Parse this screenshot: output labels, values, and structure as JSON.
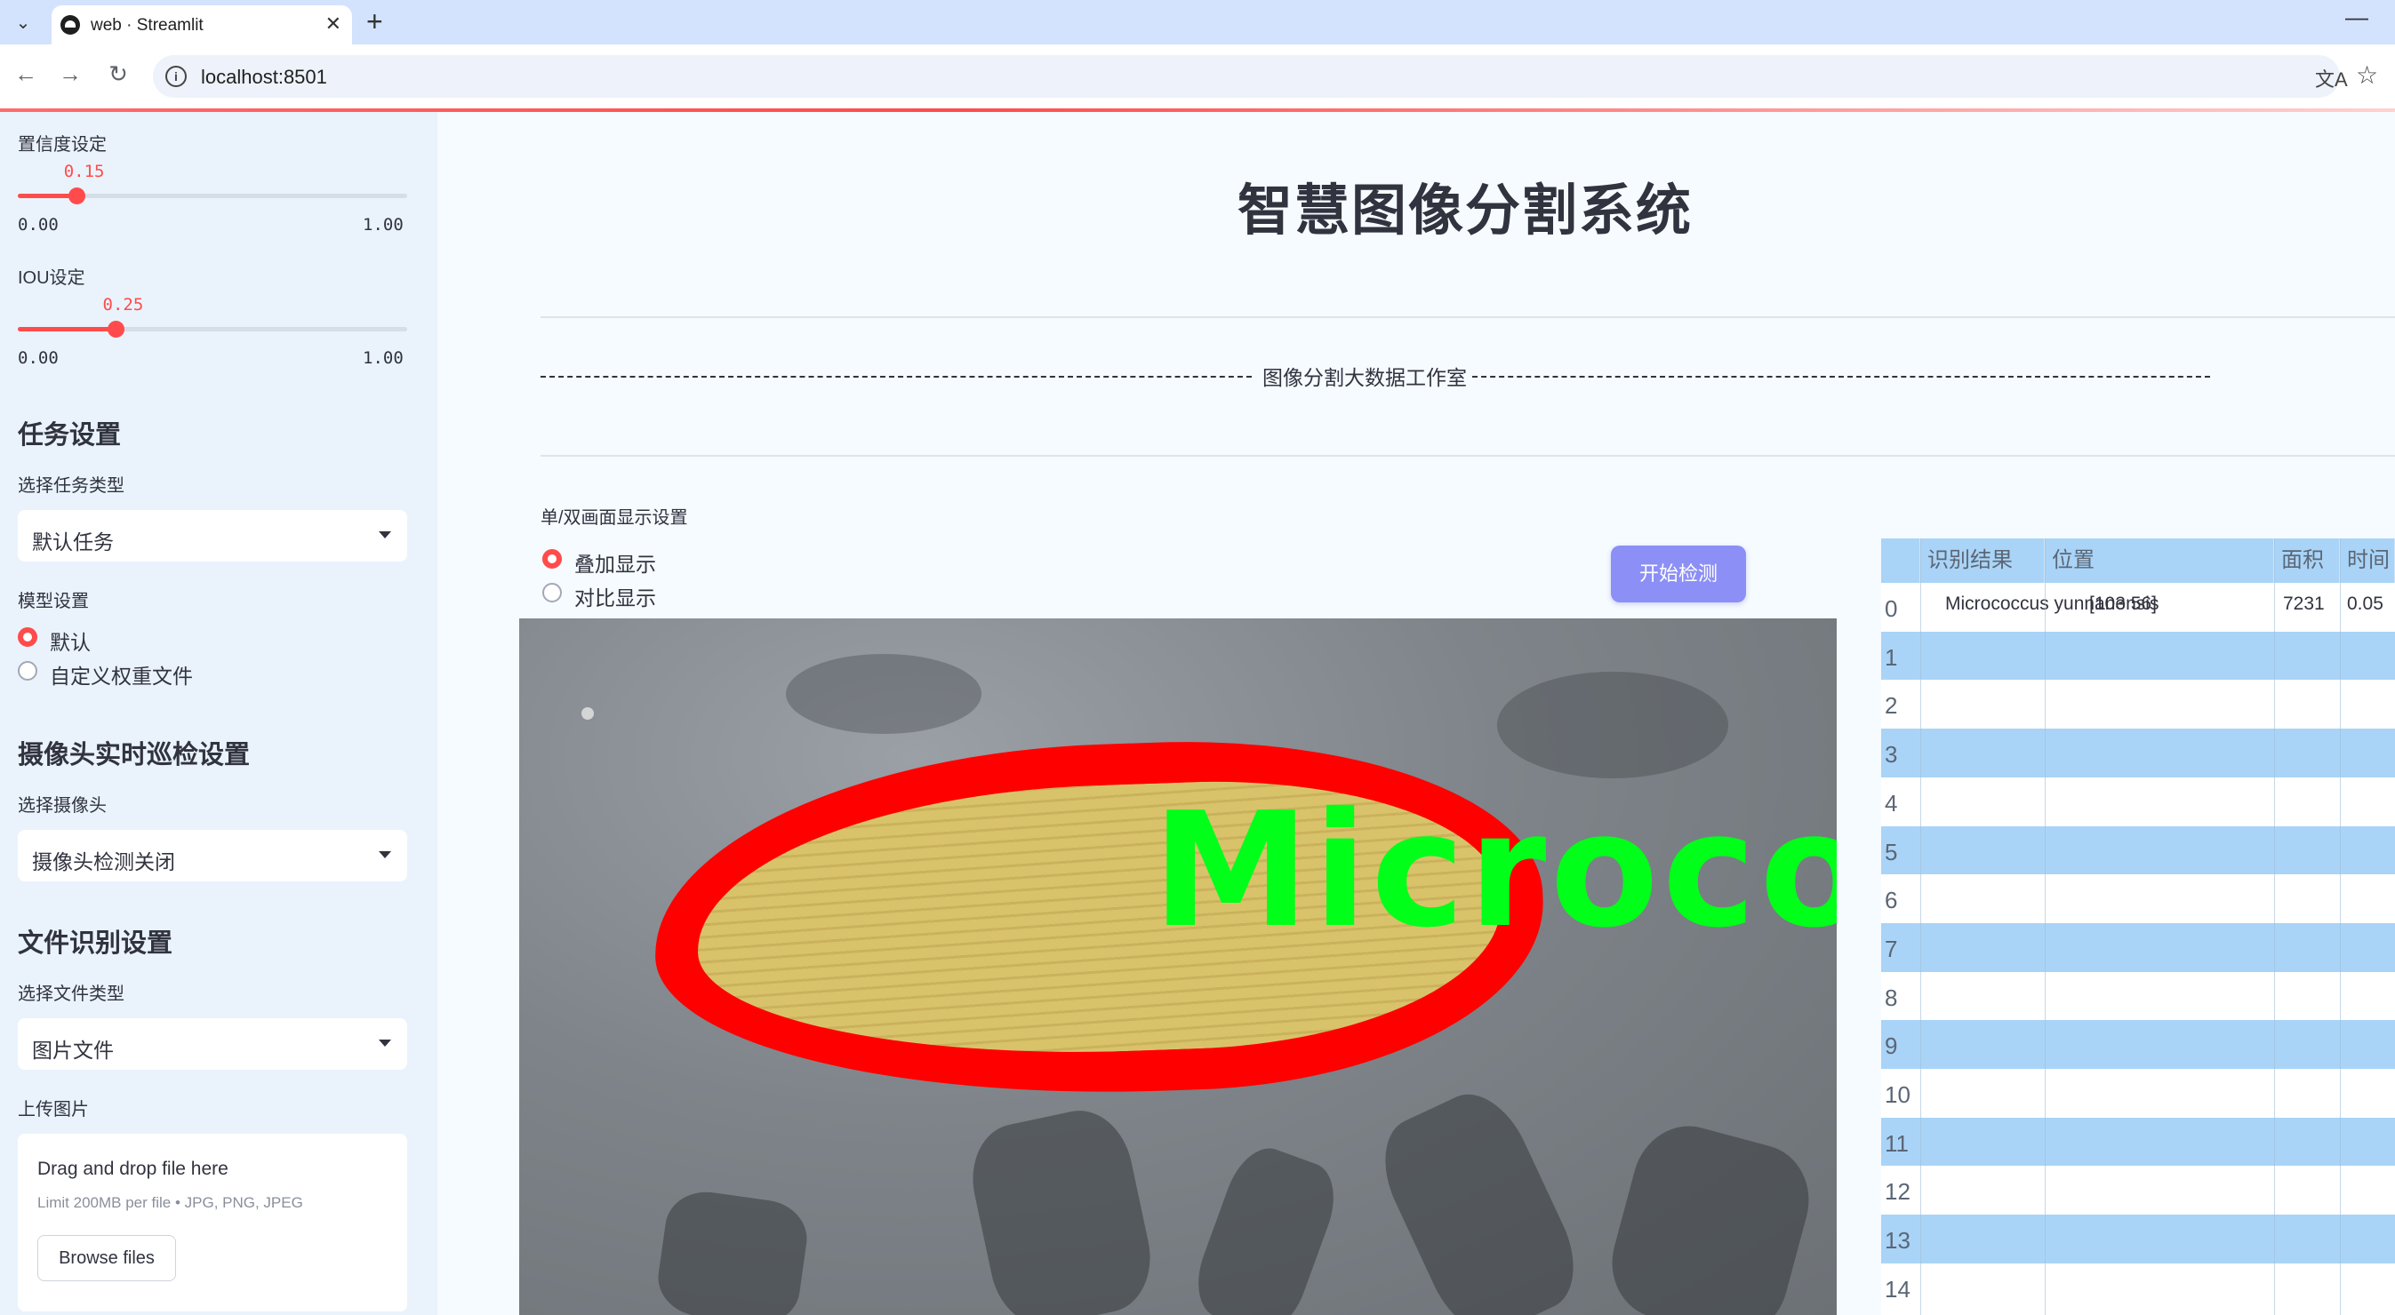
{
  "browser": {
    "tab_title": "web · Streamlit",
    "url": "localhost:8501"
  },
  "sidebar": {
    "confidence": {
      "label": "置信度设定",
      "value": "0.15",
      "value_num": 0.15,
      "min": "0.00",
      "max": "1.00"
    },
    "iou": {
      "label": "IOU设定",
      "value": "0.25",
      "value_num": 0.25,
      "min": "0.00",
      "max": "1.00"
    },
    "task_section": {
      "heading": "任务设置",
      "select_label": "选择任务类型",
      "selected": "默认任务"
    },
    "model_section": {
      "label": "模型设置",
      "options": [
        "默认",
        "自定义权重文件"
      ],
      "selected_index": 0
    },
    "camera_section": {
      "heading": "摄像头实时巡检设置",
      "select_label": "选择摄像头",
      "selected": "摄像头检测关闭"
    },
    "file_section": {
      "heading": "文件识别设置",
      "select_label": "选择文件类型",
      "selected": "图片文件"
    },
    "upload": {
      "label": "上传图片",
      "drop_text": "Drag and drop file here",
      "limit_text": "Limit 200MB per file • JPG, PNG, JPEG",
      "browse_label": "Browse files"
    }
  },
  "main": {
    "title": "智慧图像分割系统",
    "studio_text": "图像分割大数据工作室",
    "display_label": "单/双画面显示设置",
    "display_options": [
      "叠加显示",
      "对比显示"
    ],
    "display_selected_index": 0,
    "detect_button": "开始检测",
    "image_overlay_label": "Micrococ"
  },
  "results": {
    "columns": [
      "识别结果",
      "位置",
      "面积",
      "时间"
    ],
    "row_indices": [
      "0",
      "1",
      "2",
      "3",
      "4",
      "5",
      "6",
      "7",
      "8",
      "9",
      "10",
      "11",
      "12",
      "13",
      "14"
    ],
    "rows": [
      {
        "result": "Micrococcus yunnanensis",
        "position": "[103 56]",
        "area": "7231",
        "time": "0.05"
      }
    ]
  },
  "colors": {
    "accent": "#ff4b4b",
    "button": "#8c8ff5",
    "table_header": "#a9d4f7",
    "mask_outline": "#ff0000",
    "mask_fill": "#d9c36a",
    "label_text": "#00ff19"
  }
}
